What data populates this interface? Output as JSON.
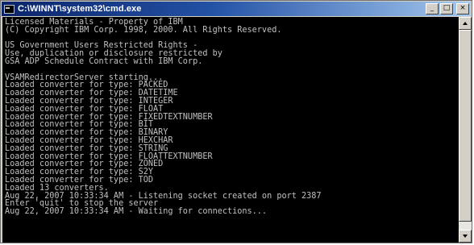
{
  "window": {
    "title": "C:\\WINNT\\system32\\cmd.exe",
    "buttons": {
      "minimize": "_",
      "maximize": "□",
      "close": "×"
    }
  },
  "console": {
    "lines": [
      "Licensed Materials - Property of IBM",
      "(C) Copyright IBM Corp. 1998, 2000. All Rights Reserved.",
      "",
      "US Government Users Restricted Rights -",
      "Use, duplication or disclosure restricted by",
      "GSA ADP Schedule Contract with IBM Corp.",
      "",
      "VSAMRedirectorServer starting...",
      "Loaded converter for type: PACKED",
      "Loaded converter for type: DATETIME",
      "Loaded converter for type: INTEGER",
      "Loaded converter for type: FLOAT",
      "Loaded converter for type: FIXEDTEXTNUMBER",
      "Loaded converter for type: BIT",
      "Loaded converter for type: BINARY",
      "Loaded converter for type: HEXCHAR",
      "Loaded converter for type: STRING",
      "Loaded converter for type: FLOATTEXTNUMBER",
      "Loaded converter for type: ZONED",
      "Loaded converter for type: S2Y",
      "Loaded converter for type: TOD",
      "Loaded 13 converters.",
      "Aug 22, 2007 10:33:34 AM - Listening socket created on port 2387",
      "Enter 'quit' to stop the server",
      "Aug 22, 2007 10:33:34 AM - Waiting for connections..."
    ]
  }
}
